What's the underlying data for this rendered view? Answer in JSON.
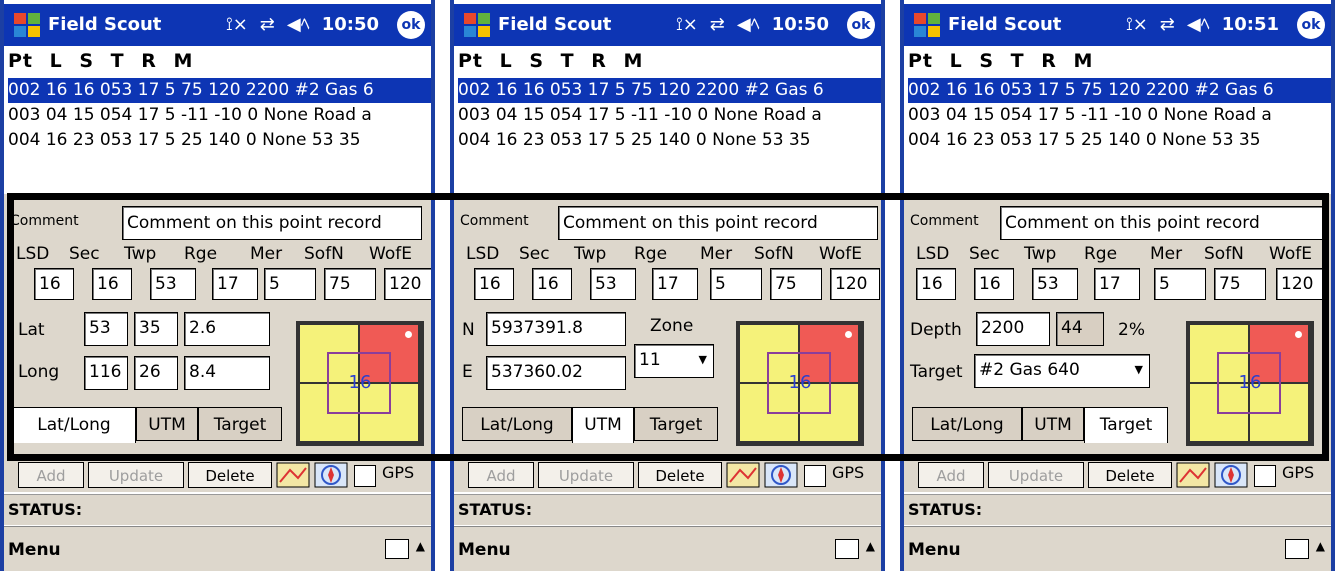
{
  "colors": {
    "title_bar": "#0d35b4",
    "selection": "#0d35b4",
    "form_bg": "#ddd7cc",
    "grid_yellow": "#f5f27a",
    "grid_red": "#f05a55",
    "grid_frame": "#8a3e9b",
    "grid_text": "#2a3fd0"
  },
  "app": {
    "title": "Field Scout",
    "ok_label": "ok",
    "signal_icon": "signal-icon",
    "sync_icon": "sync-icon",
    "volume_icon": "speaker-icon"
  },
  "times": [
    "10:50",
    "10:50",
    "10:51"
  ],
  "list": {
    "header": "Pt L S T R M",
    "rows": [
      "002 16 16 053 17 5 75 120 2200 #2 Gas 6",
      "003 04 15 054 17 5 -11 -10 0 None Road a",
      "004 16 23 053 17 5 25 140 0 None  53 35"
    ]
  },
  "form": {
    "comment_label": "Comment",
    "comment_value": "Comment on this point record",
    "headers": {
      "lsd": "LSD",
      "sec": "Sec",
      "twp": "Twp",
      "rge": "Rge",
      "mer": "Mer",
      "sofn": "SofN",
      "wofe": "WofE"
    },
    "values": {
      "lsd": "16",
      "sec": "16",
      "twp": "53",
      "rge": "17",
      "mer": "5",
      "sofn": "75",
      "wofe": "120"
    },
    "latlong": {
      "lat_label": "Lat",
      "lat_deg": "53",
      "lat_min": "35",
      "lat_sec": "2.6",
      "long_label": "Long",
      "long_deg": "116",
      "long_min": "26",
      "long_sec": "8.4"
    },
    "utm": {
      "n_label": "N",
      "n_value": "5937391.8",
      "e_label": "E",
      "e_value": "537360.02",
      "zone_label": "Zone",
      "zone_value": "11"
    },
    "target": {
      "depth_label": "Depth",
      "depth_value": "2200",
      "depth_extra": "44",
      "percent": "2%",
      "target_label": "Target",
      "target_value": "#2 Gas 640"
    },
    "tabs": [
      "Lat/Long",
      "UTM",
      "Target"
    ],
    "grid_center": "16"
  },
  "buttons": {
    "add": "Add",
    "update": "Update",
    "delete": "Delete",
    "gps": "GPS"
  },
  "status": "STATUS:",
  "menu": "Menu"
}
